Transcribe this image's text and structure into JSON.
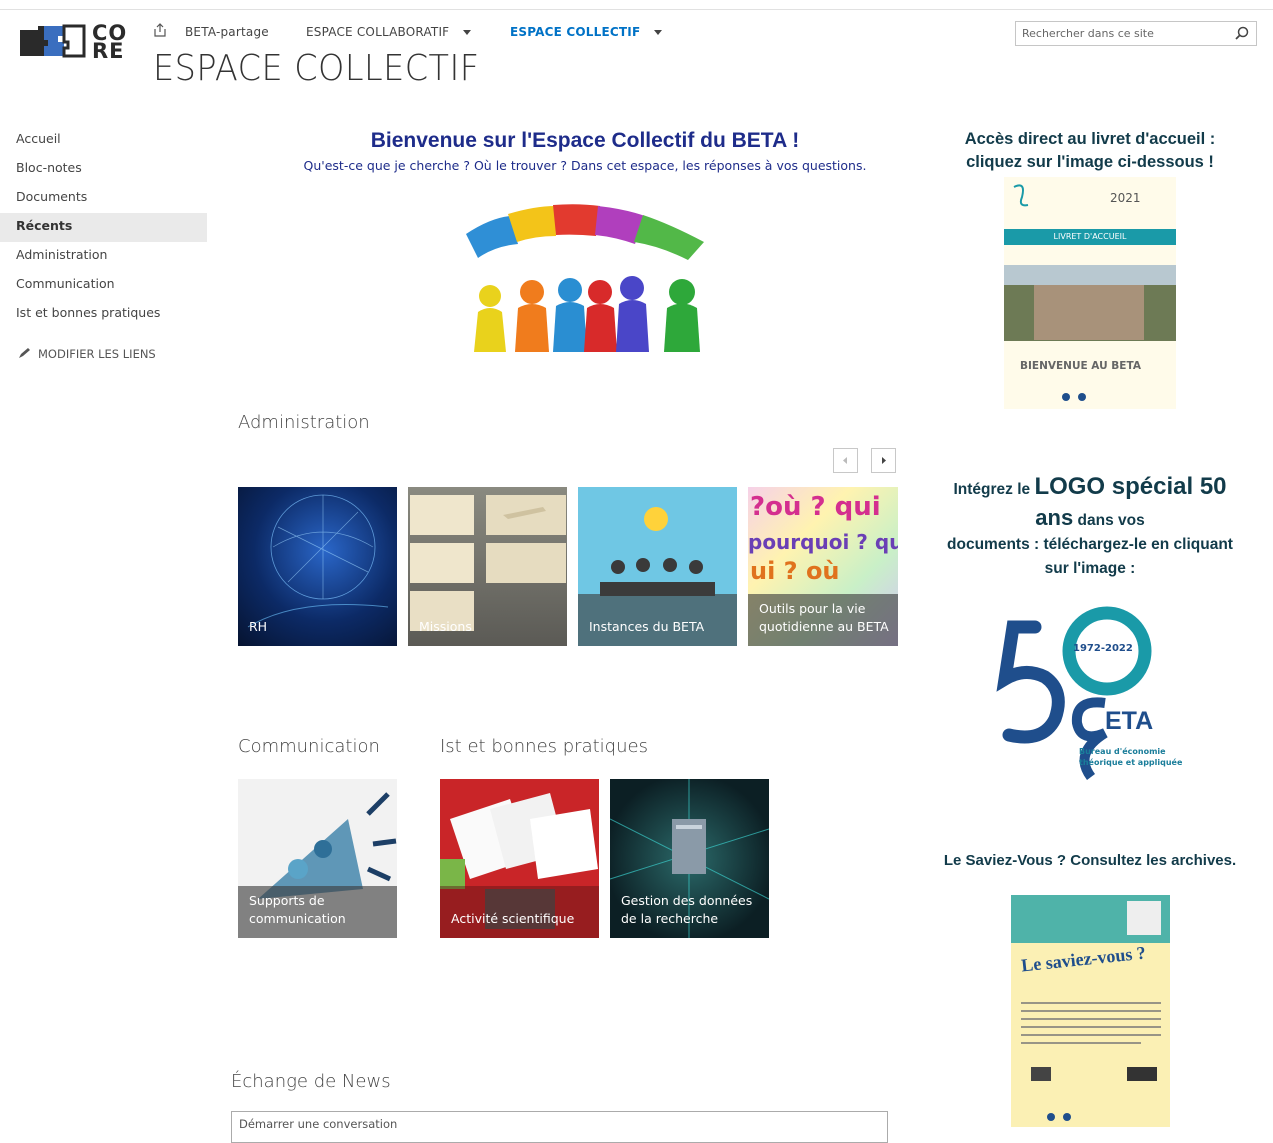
{
  "header": {
    "logo_text_top": "CO",
    "logo_text_bottom": "RE",
    "nav": [
      {
        "label": "BETA-partage"
      },
      {
        "label": "ESPACE COLLABORATIF"
      },
      {
        "label": "ESPACE COLLECTIF"
      }
    ],
    "site_title": "ESPACE COLLECTIF",
    "search_placeholder": "Rechercher dans ce site"
  },
  "sidebar": {
    "items": [
      {
        "label": "Accueil"
      },
      {
        "label": "Bloc-notes"
      },
      {
        "label": "Documents"
      },
      {
        "label": "Récents"
      },
      {
        "label": "Administration"
      },
      {
        "label": "Communication"
      },
      {
        "label": "Ist et bonnes pratiques"
      }
    ],
    "edit_links": "MODIFIER LES LIENS"
  },
  "main": {
    "welcome_title": "Bienvenue sur l'Espace Collectif du BETA !",
    "welcome_subtitle": "Qu'est-ce que je cherche ? Où le trouver ? Dans cet espace, les réponses à vos questions.",
    "administration": {
      "heading": "Administration",
      "tiles": [
        {
          "label": "RH"
        },
        {
          "label": "Missions"
        },
        {
          "label": "Instances du BETA"
        },
        {
          "label": "Outils pour la vie quotidienne au BETA"
        }
      ]
    },
    "communication": {
      "heading": "Communication",
      "tiles": [
        {
          "label": "Supports de communication"
        }
      ]
    },
    "ist": {
      "heading": "Ist et bonnes pratiques",
      "tiles": [
        {
          "label": "Activité scientifique"
        },
        {
          "label": "Gestion des données de la recherche"
        }
      ]
    },
    "news": {
      "heading": "Échange de News",
      "placeholder": "Démarrer une conversation"
    }
  },
  "right": {
    "livret_heading_line1": "Accès direct au livret d'accueil :",
    "livret_heading_line2": "cliquez sur l'image ci-dessous !",
    "livret_year": "2021",
    "livret_band": "LIVRET D'ACCUEIL",
    "livret_welcome": "BIENVENUE AU BETA",
    "logo50_pre": "Intégrez le ",
    "logo50_big1": "LOGO spécial 50",
    "logo50_big2": "ans",
    "logo50_rest": " dans vos",
    "logo50_line3": "documents : téléchargez-le en cliquant",
    "logo50_line4": "sur l'image :",
    "logo50_years": "1972-2022",
    "logo50_eta": "ETA",
    "logo50_desc1": "Bureau d'économie",
    "logo50_desc2": "théorique et appliquée",
    "saviez_heading": "Le Saviez-Vous ? Consultez les archives.",
    "saviez_poster_title": "Le saviez-vous ?"
  },
  "colors": {
    "accent_blue": "#1e2c8a",
    "nav_active": "#0072c6",
    "beta_teal": "#1a9aa8",
    "beta_navy": "#1f4e8c"
  }
}
